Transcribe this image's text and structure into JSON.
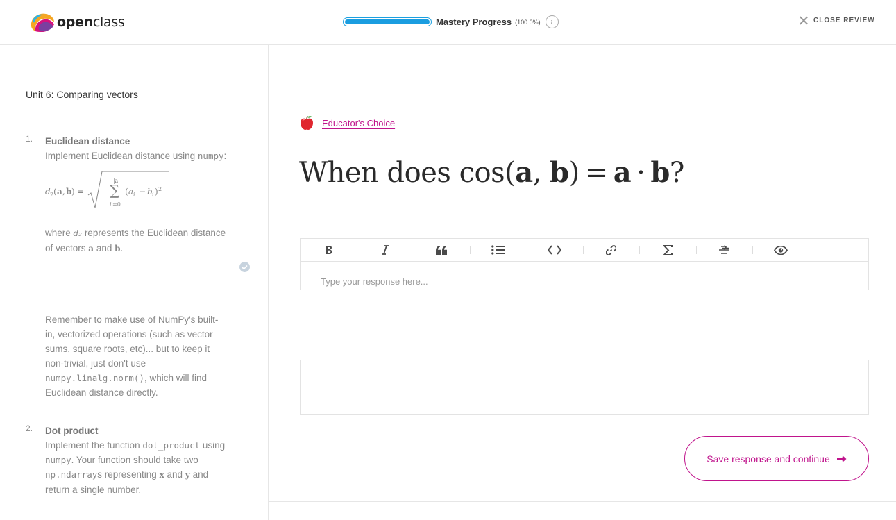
{
  "header": {
    "logo": {
      "bold": "open",
      "rest": "class"
    },
    "progress": {
      "label": "Mastery Progress",
      "percent_text": "(100.0%)",
      "value": 1.0
    },
    "info_icon": "i",
    "close_label": "CLOSE REVIEW"
  },
  "sidebar": {
    "unit_title": "Unit 6: Comparing vectors",
    "tasks": [
      {
        "number": "1.",
        "title": "Euclidean distance",
        "text_a": "Implement Euclidean distance using",
        "code_a": "numpy",
        "text_b": ":",
        "where_a": "where",
        "var_d2": "d₂",
        "where_b": "represents the Euclidean distance of vectors",
        "var_a": "a",
        "and": "and",
        "var_b": "b",
        "period": ".",
        "completed": true
      },
      {
        "number": "2.",
        "title": "Dot product",
        "text_a": "Implement the function",
        "code_a": "dot_product",
        "text_b": "using",
        "code_b": "numpy",
        "text_c": ". Your function should take two",
        "code_c": "np.ndarray",
        "text_d": "s representing",
        "var_x": "x",
        "and": "and",
        "var_y": "y",
        "text_e": "and return a single number."
      }
    ],
    "note": {
      "text_a": "Remember to make use of NumPy's built-in, vectorized operations (such as vector sums, square roots, etc)... but to keep it non-trivial, just don't use",
      "code": "numpy.linalg.norm()",
      "text_b": ", which will find Euclidean distance directly."
    }
  },
  "main": {
    "badge_label": "Educator's Choice",
    "question": {
      "prefix": "When does ",
      "func": "cos(",
      "a": "a",
      "comma": ", ",
      "b": "b",
      "close": ")",
      "eq": "=",
      "a2": "a",
      "dot": "·",
      "b2": "b",
      "suffix": "?"
    },
    "toolbar": [
      "bold-icon",
      "italic-icon",
      "quote-icon",
      "list-icon",
      "code-icon",
      "link-icon",
      "sigma-icon",
      "strikethrough-icon",
      "preview-icon"
    ],
    "editor_placeholder": "Type your response here...",
    "save_label": "Save response and continue"
  },
  "colors": {
    "accent": "#c0148c",
    "progress": "#1a9de0"
  }
}
